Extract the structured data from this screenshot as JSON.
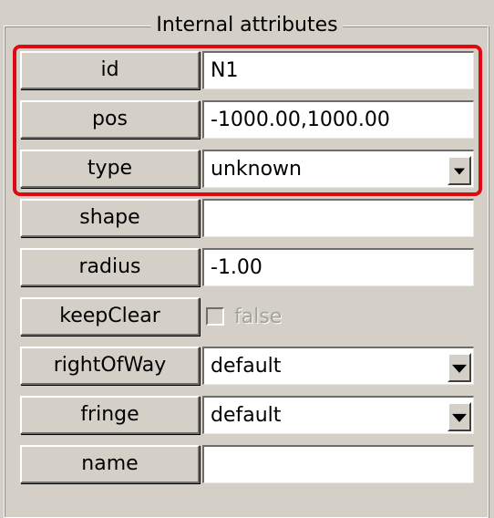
{
  "group": {
    "title": "Internal attributes"
  },
  "rows": [
    {
      "label": "id",
      "value": "N1"
    },
    {
      "label": "pos",
      "value": "-1000.00,1000.00"
    },
    {
      "label": "type",
      "value": "unknown"
    },
    {
      "label": "shape",
      "value": ""
    },
    {
      "label": "radius",
      "value": "-1.00"
    },
    {
      "label": "keepClear",
      "value": "false"
    },
    {
      "label": "rightOfWay",
      "value": "default"
    },
    {
      "label": "fringe",
      "value": "default"
    },
    {
      "label": "name",
      "value": ""
    }
  ],
  "icons": {
    "dropdown": "chevron-down-icon",
    "highlight_color": "#dd0a12"
  }
}
